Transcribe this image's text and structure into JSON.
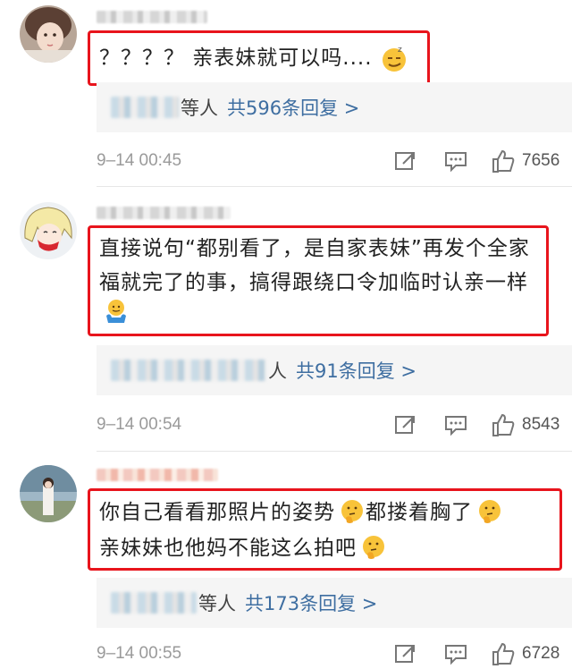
{
  "comments": [
    {
      "content": "？？？？ 亲表妹就可以吗....",
      "emoji": "smirk-face-emoji",
      "reply_suffix": "等人",
      "reply_link": "共596条回复 >",
      "timestamp": "9–14 00:45",
      "likes": "7656"
    },
    {
      "content": "直接说句“都别看了，是自家表妹”再发个全家福就完了的事，搞得跟绕口令加临时认亲一样",
      "emoji": "shrug-emoji",
      "reply_suffix": "人",
      "reply_link": "共91条回复 >",
      "timestamp": "9–14 00:54",
      "likes": "8543"
    },
    {
      "content_line1": "你自己看看那照片的姿势",
      "content_mid": "都搂着胸了",
      "content_line2": "亲妹妹也他妈不能这么拍吧",
      "emoji": "thinking-face-emoji",
      "reply_suffix": "等人",
      "reply_link": "共173条回复 >",
      "timestamp": "9–14 00:55",
      "likes": "6728"
    }
  ],
  "colors": {
    "highlight_border": "#e8141c",
    "link": "#3e6ea1",
    "meta_text": "#9a9a9a",
    "reply_bg": "#f5f5f5"
  }
}
